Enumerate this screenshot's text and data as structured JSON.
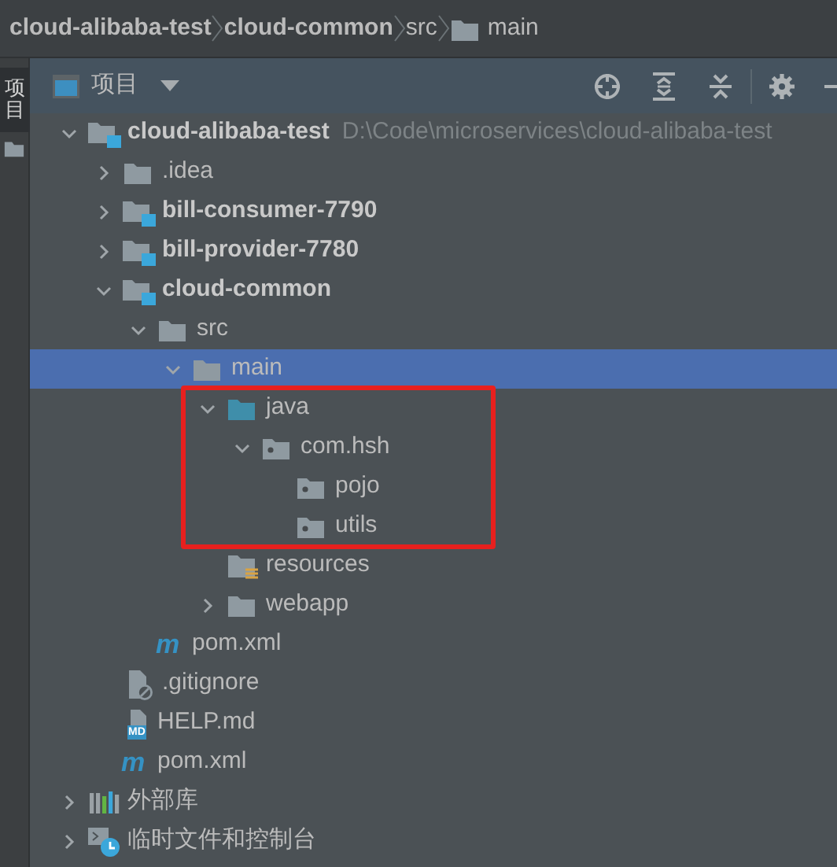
{
  "breadcrumb": [
    {
      "label": "cloud-alibaba-test",
      "bold": true,
      "kind": "plain"
    },
    {
      "label": "cloud-common",
      "bold": true,
      "kind": "plain"
    },
    {
      "label": "src",
      "bold": false,
      "kind": "plain"
    },
    {
      "label": "main",
      "bold": false,
      "kind": "folder"
    }
  ],
  "side_tabs": [
    {
      "label": "项目",
      "selected": true
    }
  ],
  "toolbar": {
    "view": "项目"
  },
  "annotation": {
    "kind": "frame",
    "color": "#e8201e"
  },
  "tree": [
    {
      "label": "cloud-alibaba-test",
      "kind": "module",
      "bold": true,
      "path": "D:\\Code\\microservices\\cloud-alibaba-test",
      "expanded": true,
      "selected": false,
      "children": [
        {
          "label": ".idea",
          "kind": "folder",
          "bold": false,
          "expanded": false,
          "selected": false
        },
        {
          "label": "bill-consumer-7790",
          "kind": "module",
          "bold": true,
          "expanded": false,
          "selected": false
        },
        {
          "label": "bill-provider-7780",
          "kind": "module",
          "bold": true,
          "expanded": false,
          "selected": false
        },
        {
          "label": "cloud-common",
          "kind": "module",
          "bold": true,
          "expanded": true,
          "selected": false,
          "children": [
            {
              "label": "src",
              "kind": "folder",
              "bold": false,
              "expanded": true,
              "selected": false,
              "children": [
                {
                  "label": "main",
                  "kind": "folder",
                  "bold": false,
                  "expanded": true,
                  "selected": true,
                  "children": [
                    {
                      "label": "java",
                      "kind": "source",
                      "bold": false,
                      "expanded": true,
                      "selected": false,
                      "framed": true,
                      "children": [
                        {
                          "label": "com.hsh",
                          "kind": "package",
                          "bold": false,
                          "expanded": true,
                          "selected": false,
                          "framed": true,
                          "children": [
                            {
                              "label": "pojo",
                              "kind": "package",
                              "bold": false,
                              "selected": false,
                              "framed": true
                            },
                            {
                              "label": "utils",
                              "kind": "package",
                              "bold": false,
                              "selected": false,
                              "framed": true
                            }
                          ]
                        }
                      ]
                    },
                    {
                      "label": "resources",
                      "kind": "resources",
                      "bold": false,
                      "selected": false
                    },
                    {
                      "label": "webapp",
                      "kind": "folder",
                      "bold": false,
                      "expanded": false,
                      "selected": false
                    }
                  ]
                }
              ]
            },
            {
              "label": "pom.xml",
              "kind": "maven",
              "badge": "m",
              "bold": false,
              "selected": false
            }
          ]
        },
        {
          "label": ".gitignore",
          "kind": "ignore",
          "bold": false,
          "selected": false
        },
        {
          "label": "HELP.md",
          "kind": "markdown",
          "badge": "MD",
          "bold": false,
          "selected": false
        },
        {
          "label": "pom.xml",
          "kind": "maven",
          "badge": "m",
          "bold": false,
          "selected": false
        }
      ]
    },
    {
      "label": "外部库",
      "kind": "libraries",
      "bold": false,
      "expanded": false,
      "selected": false
    },
    {
      "label": "临时文件和控制台",
      "kind": "scratches",
      "bold": false,
      "expanded": false,
      "selected": false
    }
  ]
}
